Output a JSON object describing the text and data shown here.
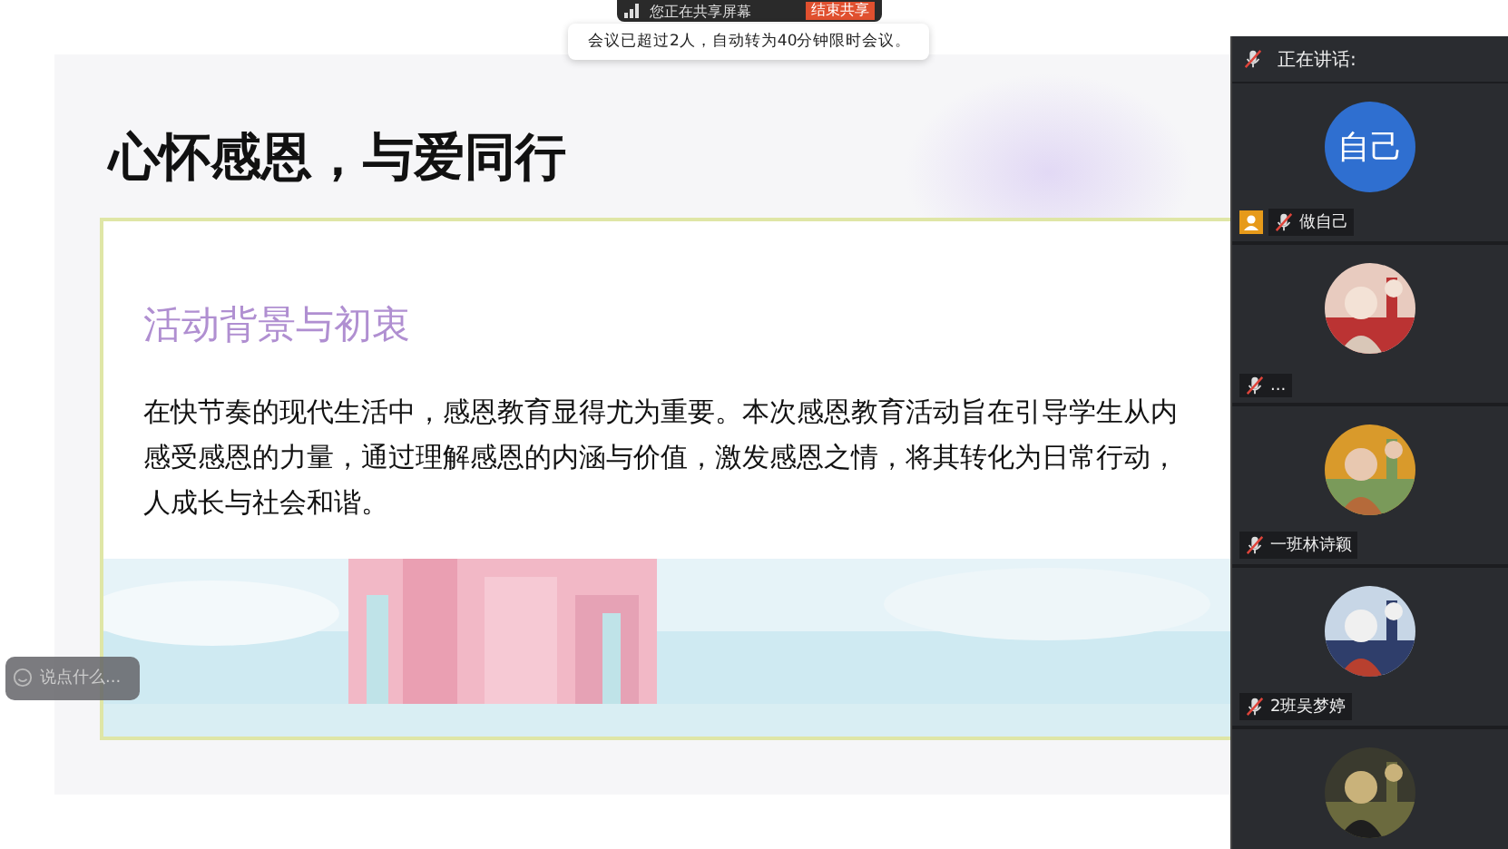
{
  "share_bar": {
    "status": "您正在共享屏幕",
    "stop_button": "结束共享"
  },
  "notice": {
    "text": "会议已超过2人，自动转为40分钟限时会议。"
  },
  "slide": {
    "title": "心怀感恩，与爱同行",
    "heading": "活动背景与初衷",
    "paragraph_lines": [
      "在快节奏的现代生活中，感恩教育显得尤为重要。本次感恩教育活动旨在引导学生从内",
      "感受感恩的力量，通过理解感恩的内涵与价值，激发感恩之情，将其转化为日常行动，",
      "人成长与社会和谐。"
    ],
    "image": {
      "kind": "picture"
    }
  },
  "chat_input": {
    "placeholder": "说点什么..."
  },
  "panel": {
    "speaking_label": "正在讲话:",
    "participants": [
      {
        "kind": "initials",
        "avatar_text": "自己",
        "name": "做自己",
        "host": true,
        "muted": true
      },
      {
        "kind": "picture",
        "name": "...",
        "host": false,
        "muted": true
      },
      {
        "kind": "picture",
        "name": "一班林诗颖",
        "host": false,
        "muted": true
      },
      {
        "kind": "picture",
        "name": "2班吴梦婷",
        "host": false,
        "muted": true
      },
      {
        "kind": "picture"
      }
    ]
  }
}
